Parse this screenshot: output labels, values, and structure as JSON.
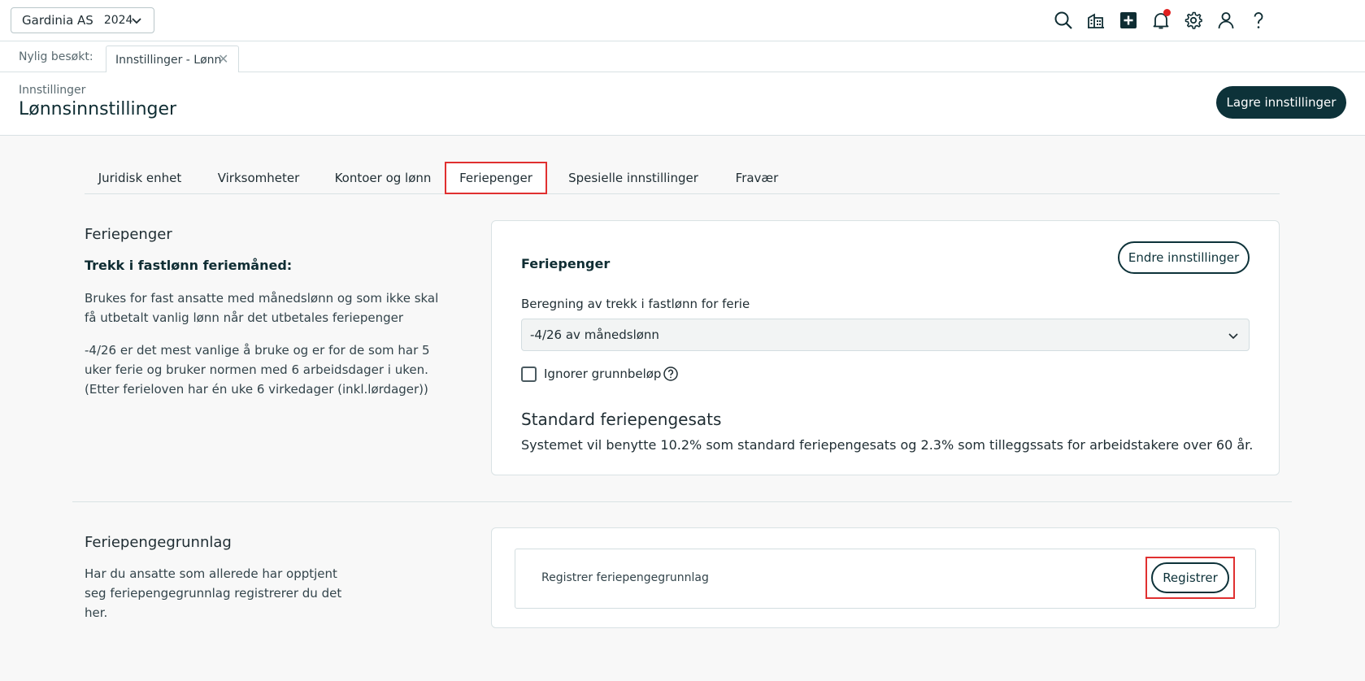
{
  "topbar": {
    "company": "Gardinia AS",
    "year": "2024",
    "icons": [
      "search-icon",
      "buildings-icon",
      "plus-square-icon",
      "bell-icon",
      "gear-icon",
      "user-icon",
      "help-icon"
    ],
    "notification_color": "#e02020"
  },
  "recent": {
    "label": "Nylig besøkt:",
    "tab": "Innstillinger - Lønn"
  },
  "header": {
    "breadcrumb": "Innstillinger",
    "title": "Lønnsinnstillinger",
    "save_label": "Lagre innstillinger",
    "accent": "#0d3239"
  },
  "tabs": [
    {
      "label": "Juridisk enhet"
    },
    {
      "label": "Virksomheter"
    },
    {
      "label": "Kontoer og lønn"
    },
    {
      "label": "Feriepenger"
    },
    {
      "label": "Spesielle innstillinger"
    },
    {
      "label": "Fravær"
    }
  ],
  "active_tab": "Feriepenger",
  "feriepenger": {
    "title": "Feriepenger",
    "subtitle": "Trekk i fastlønn feriemåned:",
    "para1": "Brukes for fast ansatte med månedslønn og som ikke skal få utbetalt vanlig lønn når det utbetales feriepenger",
    "para2": "-4/26 er det mest vanlige å bruke og er for de som har 5 uker ferie og bruker normen med 6 arbeidsdager i uken. (Etter ferieloven har én uke 6 virkedager (inkl.lørdager))",
    "card": {
      "title": "Feriepenger",
      "edit_label": "Endre innstillinger",
      "field_label": "Beregning av trekk i fastlønn for ferie",
      "selected": "-4/26 av månedslønn",
      "checkbox_label": "Ignorer grunnbeløp",
      "checkbox_checked": false,
      "std_title": "Standard feriepengesats",
      "std_text": "Systemet vil benytte 10.2% som standard feriepengesats og 2.3% som tilleggssats for arbeidstakere over 60 år."
    }
  },
  "grunnlag": {
    "title": "Feriepengegrunnlag",
    "para": "Har du ansatte som allerede har opptjent seg feriepengegrunnlag registrerer du det her.",
    "row_label": "Registrer feriepengegrunnlag",
    "button_label": "Registrer"
  }
}
